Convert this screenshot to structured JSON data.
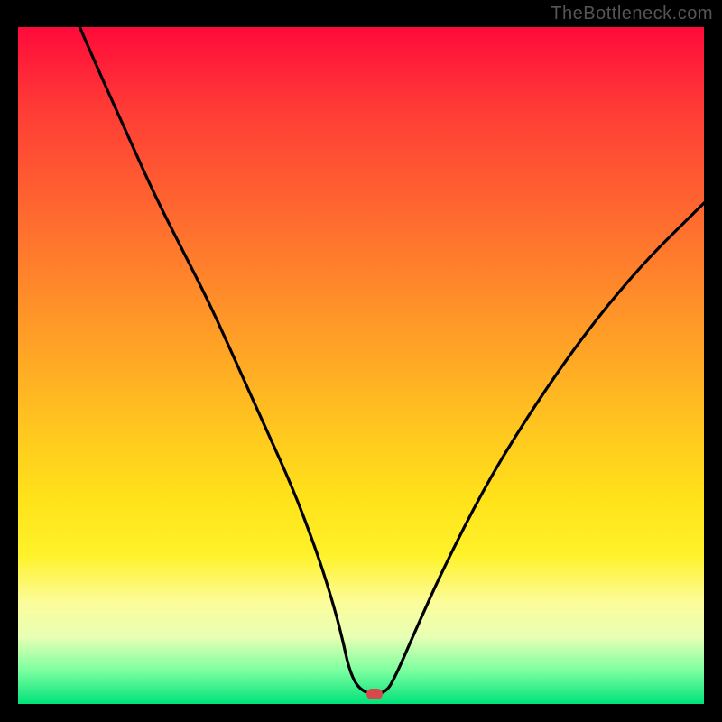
{
  "watermark": "TheBottleneck.com",
  "chart_data": {
    "type": "line",
    "title": "",
    "xlabel": "",
    "ylabel": "",
    "xlim": [
      0,
      100
    ],
    "ylim": [
      0,
      100
    ],
    "grid": false,
    "legend": false,
    "series": [
      {
        "name": "bottleneck-curve",
        "x": [
          9,
          12,
          16,
          20,
          24,
          28,
          32,
          36,
          40,
          43,
          45,
          47,
          48.5,
          50.5,
          53.5,
          55,
          58,
          62,
          68,
          74,
          80,
          86,
          92,
          98,
          100
        ],
        "values": [
          100,
          93,
          84,
          75,
          67,
          59,
          50,
          41,
          32,
          24,
          18,
          11,
          4,
          1.5,
          1.5,
          4,
          11,
          20,
          32,
          42,
          51,
          59,
          66,
          72,
          74
        ]
      }
    ],
    "flat_segment": {
      "x_start": 48.5,
      "x_end": 53.5,
      "y": 1.5
    },
    "marker": {
      "x": 52,
      "y": 1.5,
      "color": "#d8494b"
    },
    "gradient_stops": [
      {
        "pos": 0,
        "color": "#ff0a3a"
      },
      {
        "pos": 12,
        "color": "#ff3b36"
      },
      {
        "pos": 28,
        "color": "#ff6a2f"
      },
      {
        "pos": 45,
        "color": "#ff9c27"
      },
      {
        "pos": 60,
        "color": "#ffc81f"
      },
      {
        "pos": 70,
        "color": "#ffe31a"
      },
      {
        "pos": 78,
        "color": "#fff22a"
      },
      {
        "pos": 85,
        "color": "#fcfc9a"
      },
      {
        "pos": 90,
        "color": "#e9ffb4"
      },
      {
        "pos": 95,
        "color": "#7dffa0"
      },
      {
        "pos": 100,
        "color": "#00e27a"
      }
    ]
  }
}
